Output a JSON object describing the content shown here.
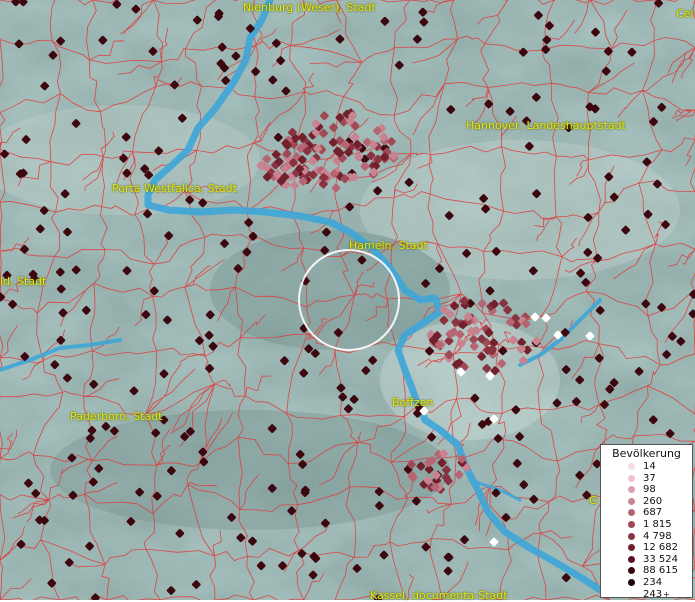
{
  "map": {
    "cities": [
      {
        "id": "nienburg",
        "label": "Nienburg (Weser), Stadt"
      },
      {
        "id": "hannover",
        "label": "Hannover, Landeshauptstadt"
      },
      {
        "id": "porta",
        "label": "Porta Westfalica, Stadt"
      },
      {
        "id": "hameln",
        "label": "Hameln, Stadt"
      },
      {
        "id": "bielefeld",
        "label": "ld, Stadt"
      },
      {
        "id": "paderborn",
        "label": "Paderborn, Stadt"
      },
      {
        "id": "boffzen",
        "label": "Boffzen"
      },
      {
        "id": "kassel",
        "label": "Kassel, documenta-Stadt"
      },
      {
        "id": "celle",
        "label": "Cel"
      },
      {
        "id": "g",
        "label": "G"
      }
    ]
  },
  "legend": {
    "title": "Bevölkerung",
    "items": [
      {
        "label": "14",
        "color": "#f6dce6"
      },
      {
        "label": "37",
        "color": "#eec3d0"
      },
      {
        "label": "98",
        "color": "#dca0ae"
      },
      {
        "label": "260",
        "color": "#c98390"
      },
      {
        "label": "687",
        "color": "#b56672"
      },
      {
        "label": "1 815",
        "color": "#a04a56"
      },
      {
        "label": "4 798",
        "color": "#8a3340"
      },
      {
        "label": "12 682",
        "color": "#72202c"
      },
      {
        "label": "33 524",
        "color": "#58111c"
      },
      {
        "label": "88 615",
        "color": "#3d0710"
      },
      {
        "label": "234 243",
        "color": "#200206",
        "suffix": "+"
      }
    ]
  }
}
